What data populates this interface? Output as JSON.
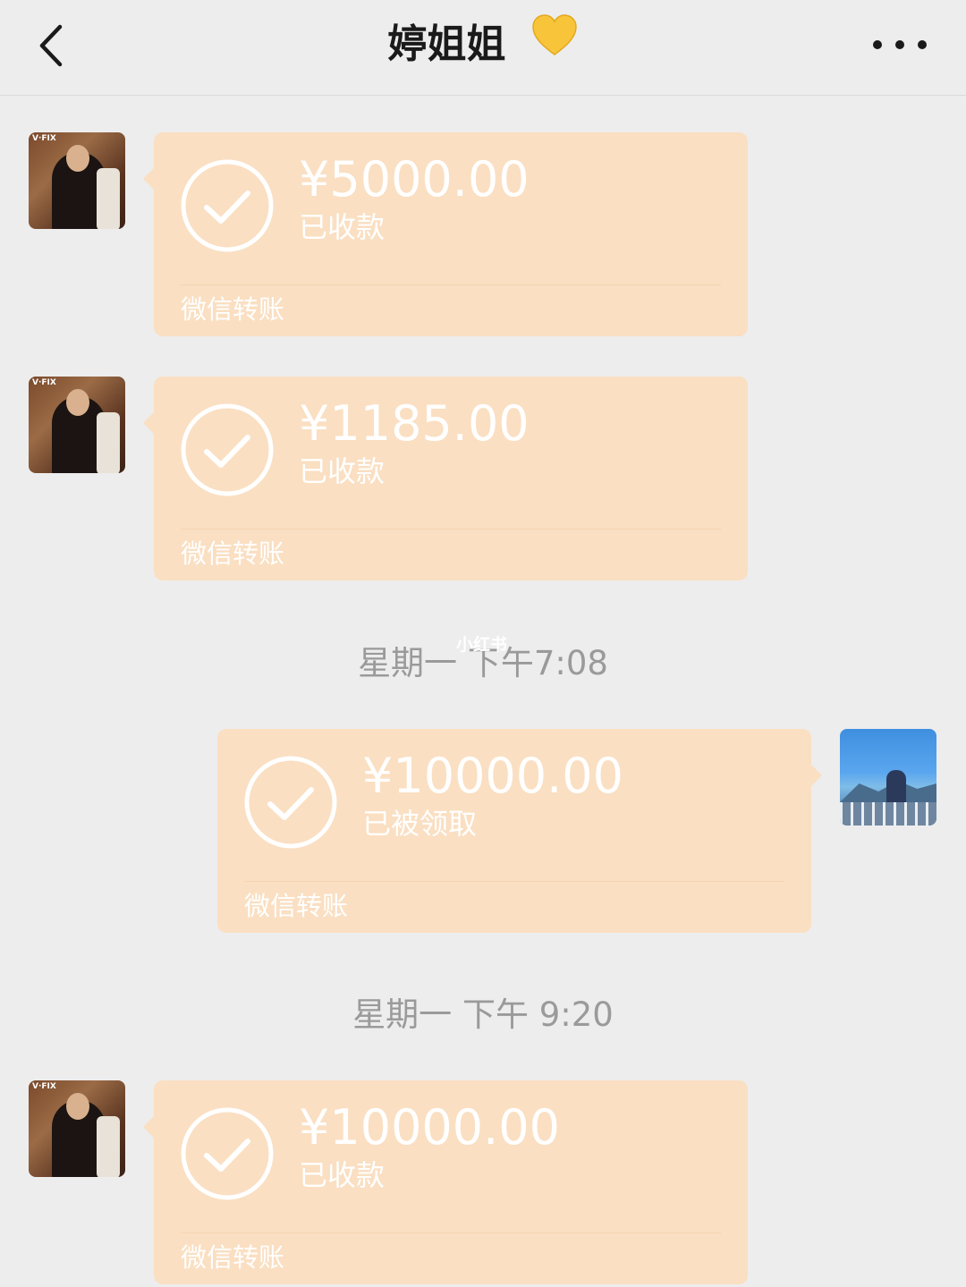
{
  "header": {
    "title": "婷姐姐",
    "title_emoji": "💛"
  },
  "messages": [
    {
      "side": "left",
      "amount": "¥5000.00",
      "status": "已收款",
      "source": "微信转账"
    },
    {
      "side": "left",
      "amount": "¥1185.00",
      "status": "已收款",
      "source": "微信转账"
    },
    {
      "side": "right",
      "amount": "¥10000.00",
      "status": "已被领取",
      "source": "微信转账"
    },
    {
      "side": "left",
      "amount": "¥10000.00",
      "status": "已收款",
      "source": "微信转账"
    }
  ],
  "timestamps": [
    "星期一 下午7:08",
    "星期一 下午 9:20"
  ],
  "watermark": "小红书",
  "colors": {
    "background": "#EDEDED",
    "bubble": "#FADFC2",
    "timestamp_text": "#9A9A9A",
    "title_text": "#1A1A1A"
  },
  "icons": {
    "back": "chevron-left-icon",
    "more": "more-dots-icon",
    "received": "check-circle-icon"
  }
}
